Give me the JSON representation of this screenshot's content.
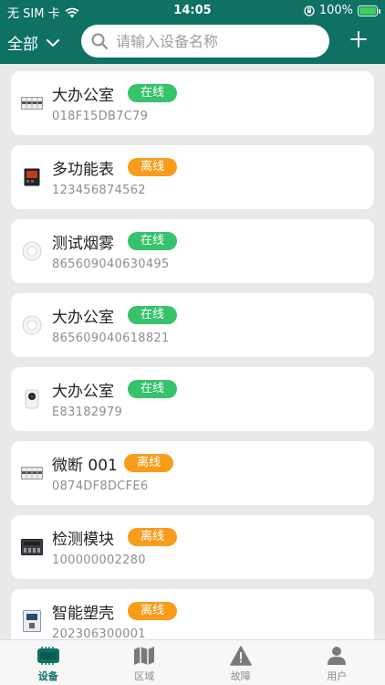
{
  "status_bar": {
    "carrier": "无 SIM 卡",
    "time": "14:05",
    "battery": "100%"
  },
  "header": {
    "filter_label": "全部",
    "search_placeholder": "请输入设备名称",
    "add_icon": "plus-icon"
  },
  "devices": [
    {
      "name": "大办公室",
      "status": "在线",
      "serial": "018F15DB7C79",
      "icon": "breaker-icon"
    },
    {
      "name": "多功能表",
      "status": "离线",
      "serial": "123456874562",
      "icon": "meter-icon"
    },
    {
      "name": "测试烟雾",
      "status": "在线",
      "serial": "865609040630495",
      "icon": "smoke-detector-icon"
    },
    {
      "name": "大办公室",
      "status": "在线",
      "serial": "865609040618821",
      "icon": "smoke-detector-icon"
    },
    {
      "name": "大办公室",
      "status": "在线",
      "serial": "E83182979",
      "icon": "camera-icon"
    },
    {
      "name": "微断 001",
      "status": "离线",
      "serial": "0874DF8DCFE6",
      "icon": "breaker-icon"
    },
    {
      "name": "检测模块",
      "status": "离线",
      "serial": "100000002280",
      "icon": "module-icon"
    },
    {
      "name": "智能塑壳",
      "status": "离线",
      "serial": "202306300001",
      "icon": "molded-case-icon"
    }
  ],
  "tabs": [
    {
      "label": "设备",
      "icon": "device-icon",
      "active": true
    },
    {
      "label": "区域",
      "icon": "map-icon",
      "active": false
    },
    {
      "label": "故障",
      "icon": "warning-icon",
      "active": false
    },
    {
      "label": "用户",
      "icon": "user-icon",
      "active": false
    }
  ],
  "colors": {
    "brand": "#0f7064",
    "online": "#37c26c",
    "offline": "#f89c1c"
  }
}
